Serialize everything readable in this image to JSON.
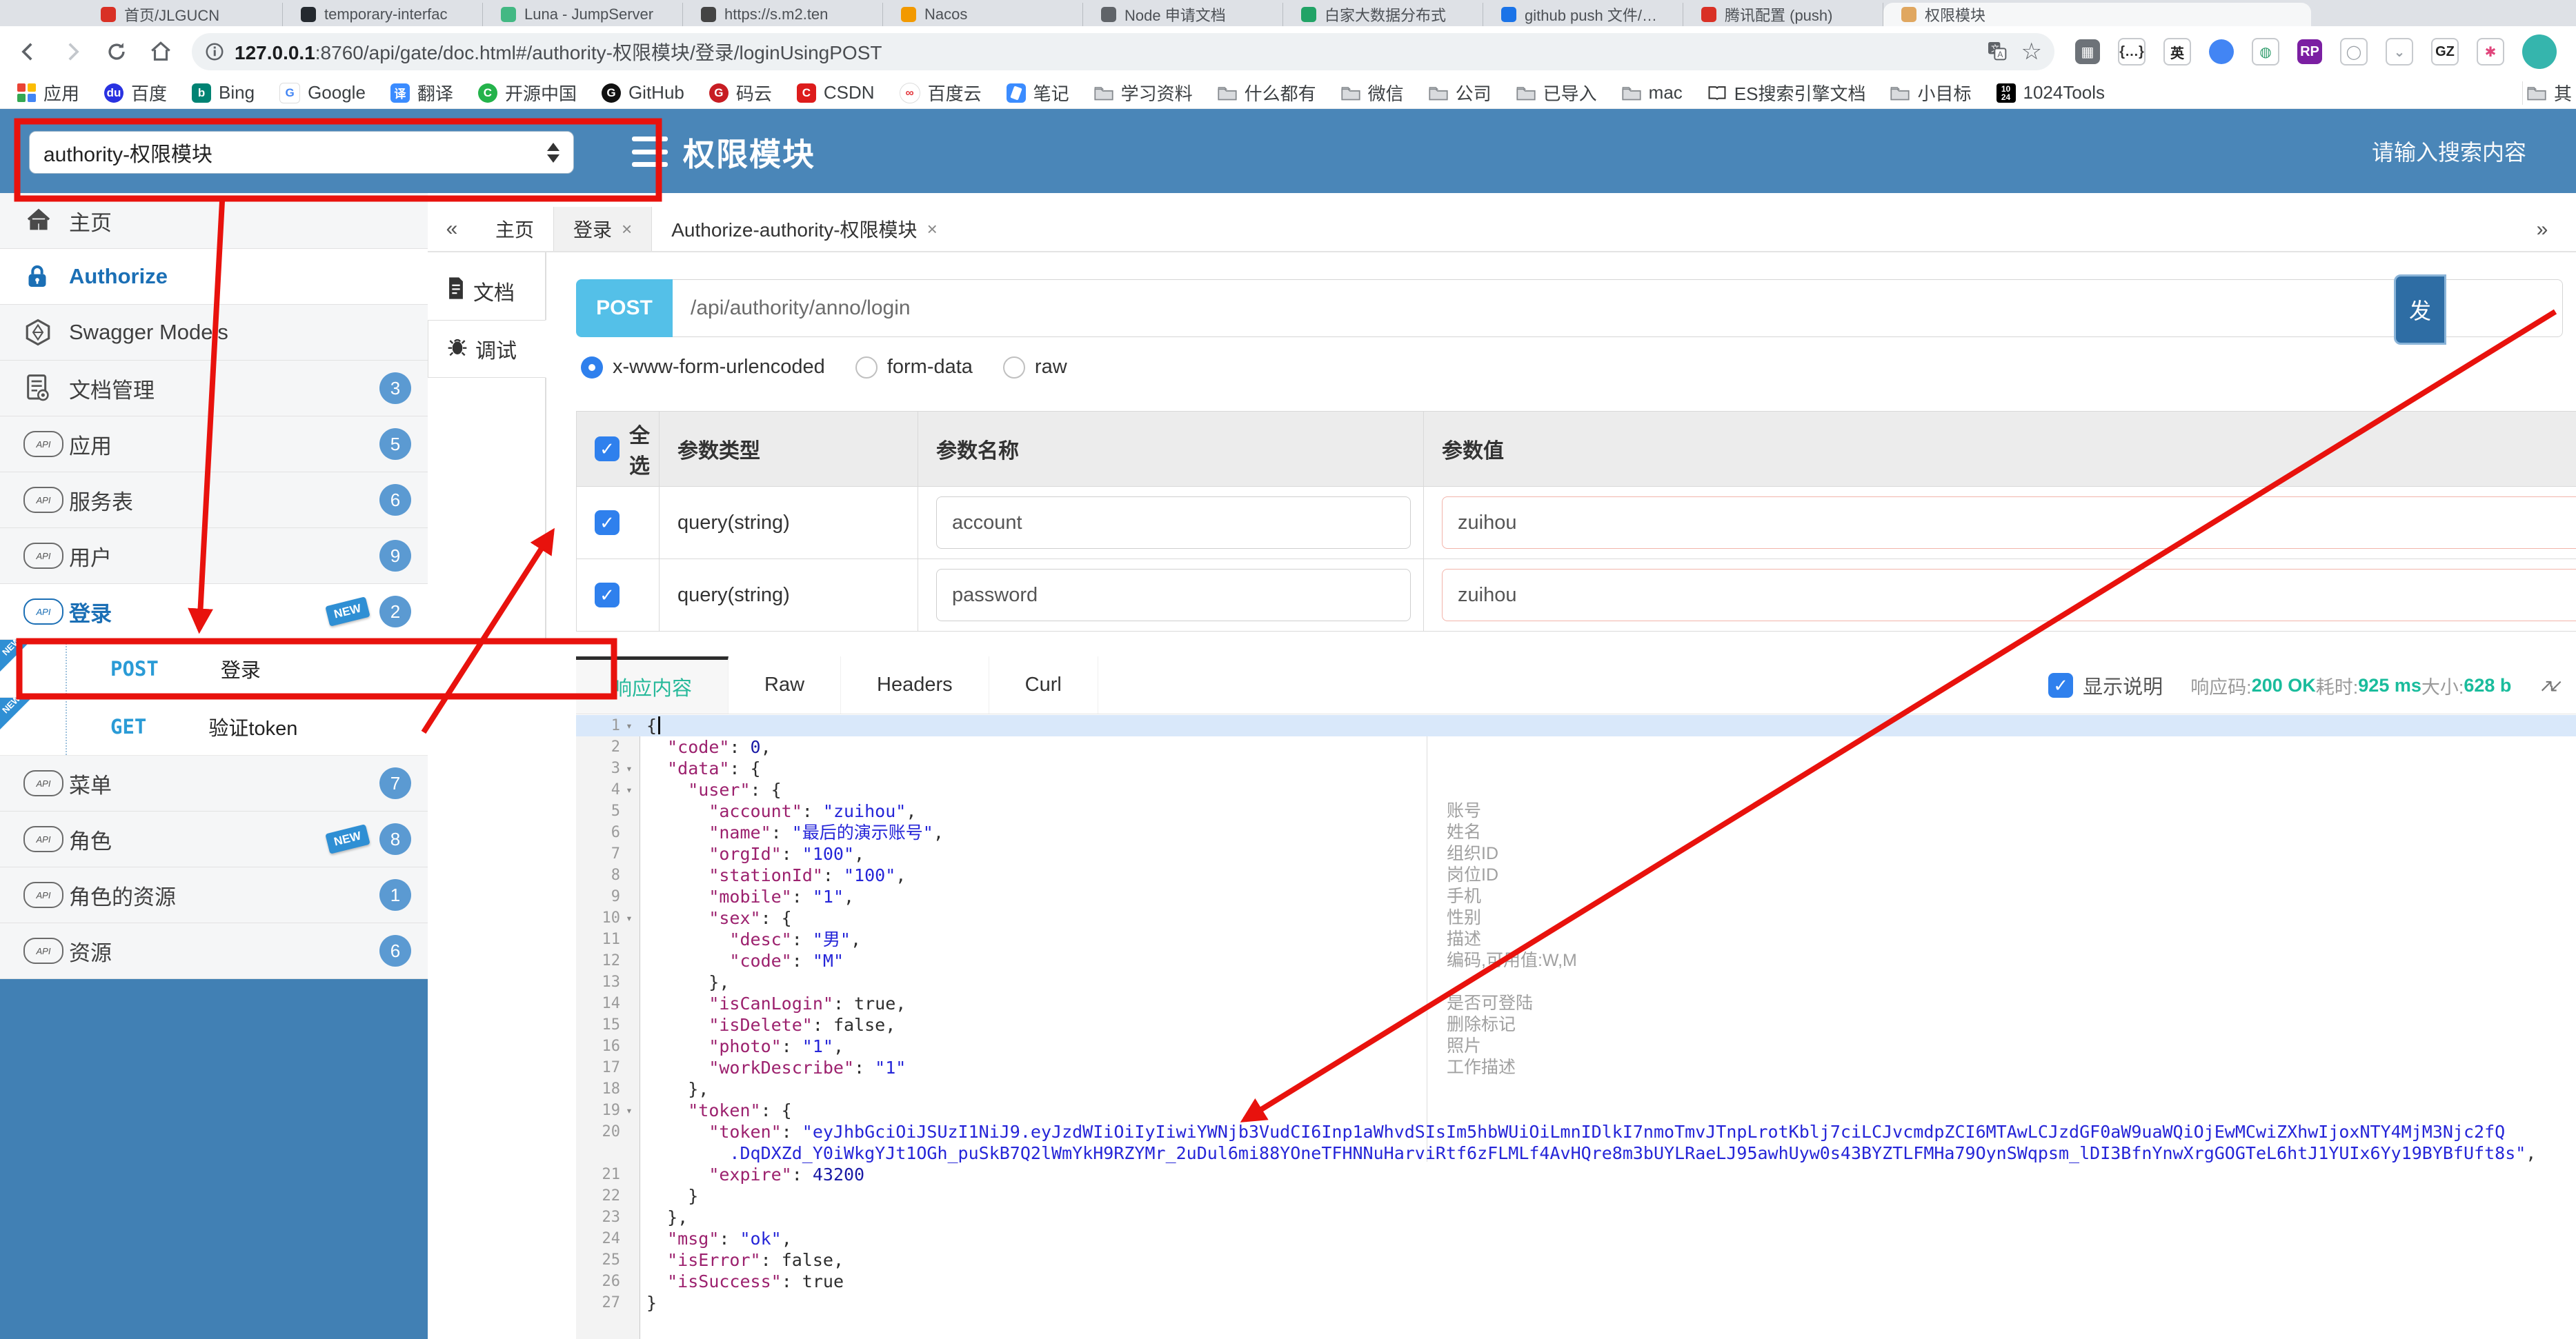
{
  "browser": {
    "tabs": [
      {
        "title": "首页/JLGUCN",
        "color": "#d93025"
      },
      {
        "title": "temporary-interfac",
        "color": "#24292f"
      },
      {
        "title": "Luna - JumpServer",
        "color": "#42b883"
      },
      {
        "title": "https://s.m2.ten",
        "color": "#444444"
      },
      {
        "title": "Nacos",
        "color": "#f29900"
      },
      {
        "title": "Node 申请文档",
        "color": "#5f6368"
      },
      {
        "title": "白家大数据分布式",
        "color": "#21a366"
      },
      {
        "title": "github push 文件/批量",
        "color": "#1a73e8"
      },
      {
        "title": "腾讯配置 (push)",
        "color": "#d93025"
      },
      {
        "title": "权限模块",
        "color": "#e0a760",
        "active": true
      }
    ],
    "url_host": "127.0.0.1",
    "url_rest": ":8760/api/gate/doc.html#/authority-权限模块/登录/loginUsingPOST",
    "bookmarks_left": [
      {
        "label": "应用",
        "icon": "grid"
      },
      {
        "label": "百度",
        "icon": "circle",
        "color": "#2932e1",
        "glyph": "du"
      },
      {
        "label": "Bing",
        "icon": "sq",
        "color": "#008373",
        "glyph": "b"
      },
      {
        "label": "Google",
        "icon": "sq",
        "color": "#ffffff",
        "glyph": "G",
        "fg": "#4285f4"
      },
      {
        "label": "翻译",
        "icon": "sq",
        "color": "#3b8cff",
        "glyph": "译"
      },
      {
        "label": "开源中国",
        "icon": "circle",
        "color": "#24b34b",
        "glyph": "C"
      },
      {
        "label": "GitHub",
        "icon": "circle",
        "color": "#111111",
        "glyph": "G"
      },
      {
        "label": "码云",
        "icon": "circle",
        "color": "#c71d23",
        "glyph": "G"
      },
      {
        "label": "CSDN",
        "icon": "sq",
        "color": "#dd1c1c",
        "glyph": "C"
      },
      {
        "label": "百度云",
        "icon": "circle",
        "color": "#ffffff",
        "glyph": "∞",
        "fg": "#e3353b"
      },
      {
        "label": "笔记",
        "icon": "note"
      },
      {
        "label": "学习资料",
        "icon": "folder"
      },
      {
        "label": "什么都有",
        "icon": "folder"
      },
      {
        "label": "微信",
        "icon": "folder"
      },
      {
        "label": "公司",
        "icon": "folder"
      },
      {
        "label": "已导入",
        "icon": "folder"
      },
      {
        "label": "mac",
        "icon": "folder"
      },
      {
        "label": "ES搜索引擎文档",
        "icon": "book"
      },
      {
        "label": "小目标",
        "icon": "folder"
      },
      {
        "label": "1024Tools",
        "icon": "num",
        "glyph": "1024"
      }
    ],
    "bookmarks_right": [
      {
        "label": "其",
        "icon": "folder"
      }
    ],
    "extensions": [
      {
        "glyph": "▦",
        "bg": "#6d7278",
        "fg": "#ffffff"
      },
      {
        "glyph": "{…}",
        "bg": "#ffffff",
        "fg": "#333333",
        "border": true
      },
      {
        "glyph": "英",
        "bg": "#ffffff",
        "fg": "#222222",
        "border": true
      },
      {
        "glyph": "",
        "bg": "#4285f4",
        "fg": "#ffffff",
        "round": true
      },
      {
        "glyph": "◍",
        "bg": "#ffffff",
        "fg": "#2e9c6b",
        "border": true
      },
      {
        "glyph": "RP",
        "bg": "#7b1fa2",
        "fg": "#ffffff"
      },
      {
        "glyph": "◯",
        "bg": "#ffffff",
        "fg": "#9aa0a6",
        "border": true
      },
      {
        "glyph": "⌄",
        "bg": "#ffffff",
        "fg": "#9aa0a6",
        "border": true
      },
      {
        "glyph": "GZ",
        "bg": "#ffffff",
        "fg": "#222222",
        "border": true
      },
      {
        "glyph": "✱",
        "bg": "#ffffff",
        "fg": "#e0457b",
        "border": true
      }
    ]
  },
  "header": {
    "module_select": "authority-权限模块",
    "title": "权限模块",
    "search_placeholder": "请输入搜索内容"
  },
  "sidebar": {
    "items": [
      {
        "type": "home",
        "label": "主页"
      },
      {
        "type": "lock",
        "label": "Authorize",
        "active": true
      },
      {
        "type": "hex",
        "label": "Swagger Models"
      },
      {
        "type": "docgear",
        "label": "文档管理",
        "badge": "3"
      },
      {
        "type": "cloud",
        "label": "应用",
        "badge": "5"
      },
      {
        "type": "cloud",
        "label": "服务表",
        "badge": "6"
      },
      {
        "type": "cloud",
        "label": "用户",
        "badge": "9"
      },
      {
        "type": "cloud",
        "label": "登录",
        "badge": "2",
        "new": true,
        "active": true
      },
      {
        "method": "POST",
        "label": "登录",
        "new_corner": true,
        "boxed": true
      },
      {
        "method": "GET",
        "label": "验证token",
        "new_corner": true
      },
      {
        "type": "cloud",
        "label": "菜单",
        "badge": "7"
      },
      {
        "type": "cloud",
        "label": "角色",
        "badge": "8",
        "new": true
      },
      {
        "type": "cloud",
        "label": "角色的资源",
        "badge": "1"
      },
      {
        "type": "cloud",
        "label": "资源",
        "badge": "6"
      }
    ]
  },
  "doc_tabs": {
    "collapse": "«",
    "expand": "»",
    "tabs": [
      {
        "label": "主页"
      },
      {
        "label": "登录",
        "close": "×",
        "active": true
      },
      {
        "label": "Authorize-authority-权限模块",
        "close": "×"
      }
    ]
  },
  "vtabs": [
    {
      "label": "文档",
      "icon": "doc"
    },
    {
      "label": "调试",
      "icon": "debug",
      "active": true
    }
  ],
  "endpoint": {
    "method": "POST",
    "path": "/api/authority/anno/login",
    "send": "发"
  },
  "body_types": [
    {
      "label": "x-www-form-urlencoded",
      "selected": true
    },
    {
      "label": "form-data"
    },
    {
      "label": "raw"
    }
  ],
  "params": {
    "headers": [
      "全选",
      "参数类型",
      "参数名称",
      "参数值"
    ],
    "rows": [
      {
        "checked": true,
        "type": "query(string)",
        "name": "account",
        "value": "zuihou"
      },
      {
        "checked": true,
        "type": "query(string)",
        "name": "password",
        "value": "zuihou"
      }
    ]
  },
  "response": {
    "tabs": [
      {
        "label": "响应内容",
        "active": true
      },
      {
        "label": "Raw"
      },
      {
        "label": "Headers"
      },
      {
        "label": "Curl"
      }
    ],
    "show_desc": "显示说明",
    "status": [
      {
        "label": "响应码:",
        "value": "200 OK"
      },
      {
        "label": "耗时:",
        "value": "925 ms"
      },
      {
        "label": "大小:",
        "value": "628 b"
      }
    ]
  },
  "code": {
    "lines": [
      {
        "n": "1",
        "fold": true,
        "hl": true,
        "cursor": true,
        "s": [
          [
            "p",
            "{"
          ]
        ]
      },
      {
        "n": "2",
        "s": [
          [
            "p",
            "  "
          ],
          [
            "k",
            "\"code\""
          ],
          [
            "p",
            ": "
          ],
          [
            "n",
            "0"
          ],
          [
            "p",
            ","
          ]
        ]
      },
      {
        "n": "3",
        "fold": true,
        "s": [
          [
            "p",
            "  "
          ],
          [
            "k",
            "\"data\""
          ],
          [
            "p",
            ": {"
          ]
        ]
      },
      {
        "n": "4",
        "fold": true,
        "s": [
          [
            "p",
            "    "
          ],
          [
            "k",
            "\"user\""
          ],
          [
            "p",
            ": {"
          ]
        ]
      },
      {
        "n": "5",
        "ann": "账号",
        "s": [
          [
            "p",
            "      "
          ],
          [
            "k",
            "\"account\""
          ],
          [
            "p",
            ": "
          ],
          [
            "s",
            "\"zuihou\""
          ],
          [
            "p",
            ","
          ]
        ]
      },
      {
        "n": "6",
        "ann": "姓名",
        "s": [
          [
            "p",
            "      "
          ],
          [
            "k",
            "\"name\""
          ],
          [
            "p",
            ": "
          ],
          [
            "s",
            "\"最后的演示账号\""
          ],
          [
            "p",
            ","
          ]
        ]
      },
      {
        "n": "7",
        "ann": "组织ID",
        "s": [
          [
            "p",
            "      "
          ],
          [
            "k",
            "\"orgId\""
          ],
          [
            "p",
            ": "
          ],
          [
            "s",
            "\"100\""
          ],
          [
            "p",
            ","
          ]
        ]
      },
      {
        "n": "8",
        "ann": "岗位ID",
        "s": [
          [
            "p",
            "      "
          ],
          [
            "k",
            "\"stationId\""
          ],
          [
            "p",
            ": "
          ],
          [
            "s",
            "\"100\""
          ],
          [
            "p",
            ","
          ]
        ]
      },
      {
        "n": "9",
        "ann": "手机",
        "s": [
          [
            "p",
            "      "
          ],
          [
            "k",
            "\"mobile\""
          ],
          [
            "p",
            ": "
          ],
          [
            "s",
            "\"1\""
          ],
          [
            "p",
            ","
          ]
        ]
      },
      {
        "n": "10",
        "fold": true,
        "ann": "性别",
        "s": [
          [
            "p",
            "      "
          ],
          [
            "k",
            "\"sex\""
          ],
          [
            "p",
            ": {"
          ]
        ]
      },
      {
        "n": "11",
        "ann": "描述",
        "s": [
          [
            "p",
            "        "
          ],
          [
            "k",
            "\"desc\""
          ],
          [
            "p",
            ": "
          ],
          [
            "s",
            "\"男\""
          ],
          [
            "p",
            ","
          ]
        ]
      },
      {
        "n": "12",
        "ann": "编码,可用值:W,M",
        "s": [
          [
            "p",
            "        "
          ],
          [
            "k",
            "\"code\""
          ],
          [
            "p",
            ": "
          ],
          [
            "s",
            "\"M\""
          ]
        ]
      },
      {
        "n": "13",
        "s": [
          [
            "p",
            "      },"
          ]
        ]
      },
      {
        "n": "14",
        "ann": "是否可登陆",
        "s": [
          [
            "p",
            "      "
          ],
          [
            "k",
            "\"isCanLogin\""
          ],
          [
            "p",
            ": "
          ],
          [
            "b",
            "true"
          ],
          [
            "p",
            ","
          ]
        ]
      },
      {
        "n": "15",
        "ann": "删除标记",
        "s": [
          [
            "p",
            "      "
          ],
          [
            "k",
            "\"isDelete\""
          ],
          [
            "p",
            ": "
          ],
          [
            "b",
            "false"
          ],
          [
            "p",
            ","
          ]
        ]
      },
      {
        "n": "16",
        "ann": "照片",
        "s": [
          [
            "p",
            "      "
          ],
          [
            "k",
            "\"photo\""
          ],
          [
            "p",
            ": "
          ],
          [
            "s",
            "\"1\""
          ],
          [
            "p",
            ","
          ]
        ]
      },
      {
        "n": "17",
        "ann": "工作描述",
        "s": [
          [
            "p",
            "      "
          ],
          [
            "k",
            "\"workDescribe\""
          ],
          [
            "p",
            ": "
          ],
          [
            "s",
            "\"1\""
          ]
        ]
      },
      {
        "n": "18",
        "s": [
          [
            "p",
            "    },"
          ]
        ]
      },
      {
        "n": "19",
        "fold": true,
        "s": [
          [
            "p",
            "    "
          ],
          [
            "k",
            "\"token\""
          ],
          [
            "p",
            ": {"
          ]
        ]
      },
      {
        "n": "20",
        "s": [
          [
            "p",
            "      "
          ],
          [
            "k",
            "\"token\""
          ],
          [
            "p",
            ": "
          ],
          [
            "s",
            "\"eyJhbGciOiJSUzI1NiJ9.eyJzdWIiOiIyIiwiYWNjb3VudCI6Inp1aWhvdSIsIm5hbWUiOiLmnIDlkI7nmoTmvJTnpLrotKblj7ciLCJvcmdpZCI6MTAwLCJzdGF0aW9uaWQiOjEwMCwiZXhwIjoxNTY4MjM3Njc2fQ"
          ]
        ]
      },
      {
        "n": "",
        "s": [
          [
            "p",
            "        "
          ],
          [
            "s",
            ".DqDXZd_Y0iWkgYJt1OGh_puSkB7Q2lWmYkH9RZYMr_2uDul6mi88YOneTFHNNuHarviRtf6zFLMLf4AvHQre8m3bUYLRaeLJ95awhUyw0s43BYZTLFMHa79OynSWqpsm_lDI3BfnYnwXrgGOGTeL6htJ1YUIx6Yy19BYBfUft8s\""
          ],
          [
            "p",
            ","
          ]
        ]
      },
      {
        "n": "21",
        "s": [
          [
            "p",
            "      "
          ],
          [
            "k",
            "\"expire\""
          ],
          [
            "p",
            ": "
          ],
          [
            "n",
            "43200"
          ]
        ]
      },
      {
        "n": "22",
        "s": [
          [
            "p",
            "    }"
          ]
        ]
      },
      {
        "n": "23",
        "s": [
          [
            "p",
            "  },"
          ]
        ]
      },
      {
        "n": "24",
        "s": [
          [
            "p",
            "  "
          ],
          [
            "k",
            "\"msg\""
          ],
          [
            "p",
            ": "
          ],
          [
            "s",
            "\"ok\""
          ],
          [
            "p",
            ","
          ]
        ]
      },
      {
        "n": "25",
        "s": [
          [
            "p",
            "  "
          ],
          [
            "k",
            "\"isError\""
          ],
          [
            "p",
            ": "
          ],
          [
            "b",
            "false"
          ],
          [
            "p",
            ","
          ]
        ]
      },
      {
        "n": "26",
        "s": [
          [
            "p",
            "  "
          ],
          [
            "k",
            "\"isSuccess\""
          ],
          [
            "p",
            ": "
          ],
          [
            "b",
            "true"
          ]
        ]
      },
      {
        "n": "27",
        "s": [
          [
            "p",
            "}"
          ]
        ]
      }
    ]
  }
}
